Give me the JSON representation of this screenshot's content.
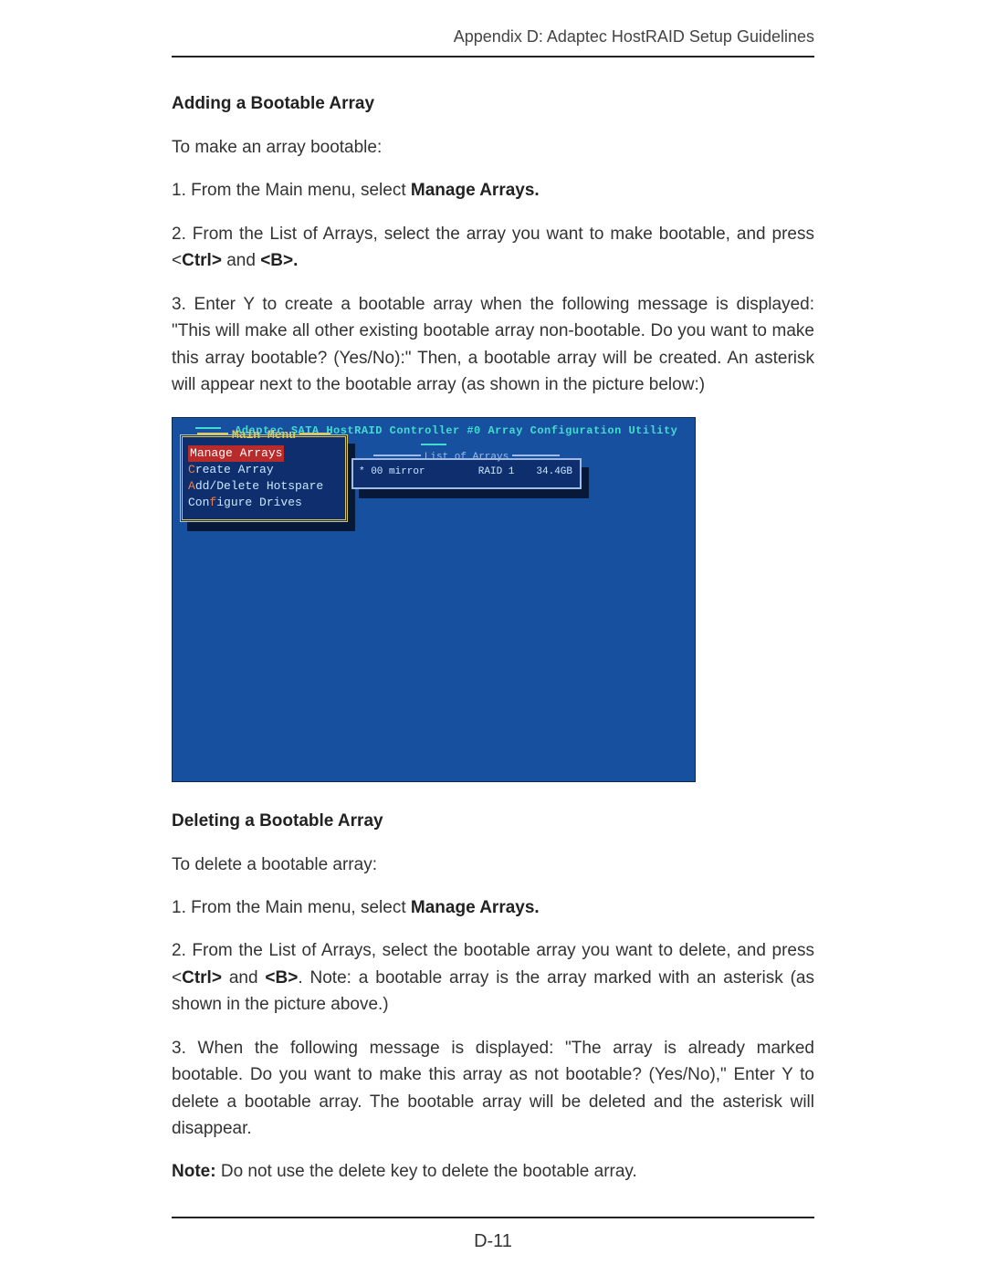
{
  "header": {
    "running_head": "Appendix D: Adaptec HostRAID Setup Guidelines"
  },
  "section1": {
    "title": "Adding a Bootable Array",
    "intro": "To make an array bootable:",
    "step1_a": "1. From the Main menu, select ",
    "step1_b": "Manage Arrays.",
    "step2_a": "2. From the List of Arrays, select the array you want to make bootable, and press <",
    "step2_b": "Ctrl>",
    "step2_c": " and ",
    "step2_d": "<B>.",
    "step3": "3. Enter Y to create a bootable array when the following message is displayed: \"This will make all other existing bootable array non-bootable. Do you want to make this array bootable? (Yes/No):\"  Then, a bootable array will be created.  An asterisk will appear next to the bootable array (as shown in the picture below:)"
  },
  "figure": {
    "title": "Adaptec SATA HostRAID Controller #0 Array Configuration Utility",
    "main_menu": {
      "caption": "Main Menu",
      "items": [
        {
          "hot": "M",
          "rest": "anage Arrays",
          "selected": true
        },
        {
          "hot": "C",
          "rest": "reate Array",
          "selected": false
        },
        {
          "hot": "A",
          "rest": "dd/Delete Hotspare",
          "selected": false
        },
        {
          "hot": "Con",
          "hot_f": "f",
          "rest": "igure Drives",
          "selected": false
        }
      ]
    },
    "list_of_arrays": {
      "caption": "List of Arrays",
      "row": {
        "col1": "* 00 mirror",
        "col2": "RAID 1",
        "col3": "34.4GB"
      }
    }
  },
  "section2": {
    "title": "Deleting a Bootable Array",
    "intro": "To delete a bootable array:",
    "step1_a": "1. From the Main menu, select ",
    "step1_b": "Manage Arrays.",
    "step2_a": "2. From the List of Arrays, select the bootable array you want to delete, and press <",
    "step2_b": "Ctrl>",
    "step2_c": " and ",
    "step2_d": "<B>",
    "step2_e": ". Note: a bootable array is the array marked with an asterisk   (as shown in the picture above.)",
    "step3": "3. When the following message is displayed: \"The array is already marked bootable. Do you want to make this array as not bootable? (Yes/No),\" Enter Y to delete a bootable array.  The bootable array will be deleted and the asterisk will disappear.",
    "note_label": "Note:",
    "note_body": " Do not use the delete key to delete the bootable array."
  },
  "footer": {
    "page_number": "D-11"
  }
}
